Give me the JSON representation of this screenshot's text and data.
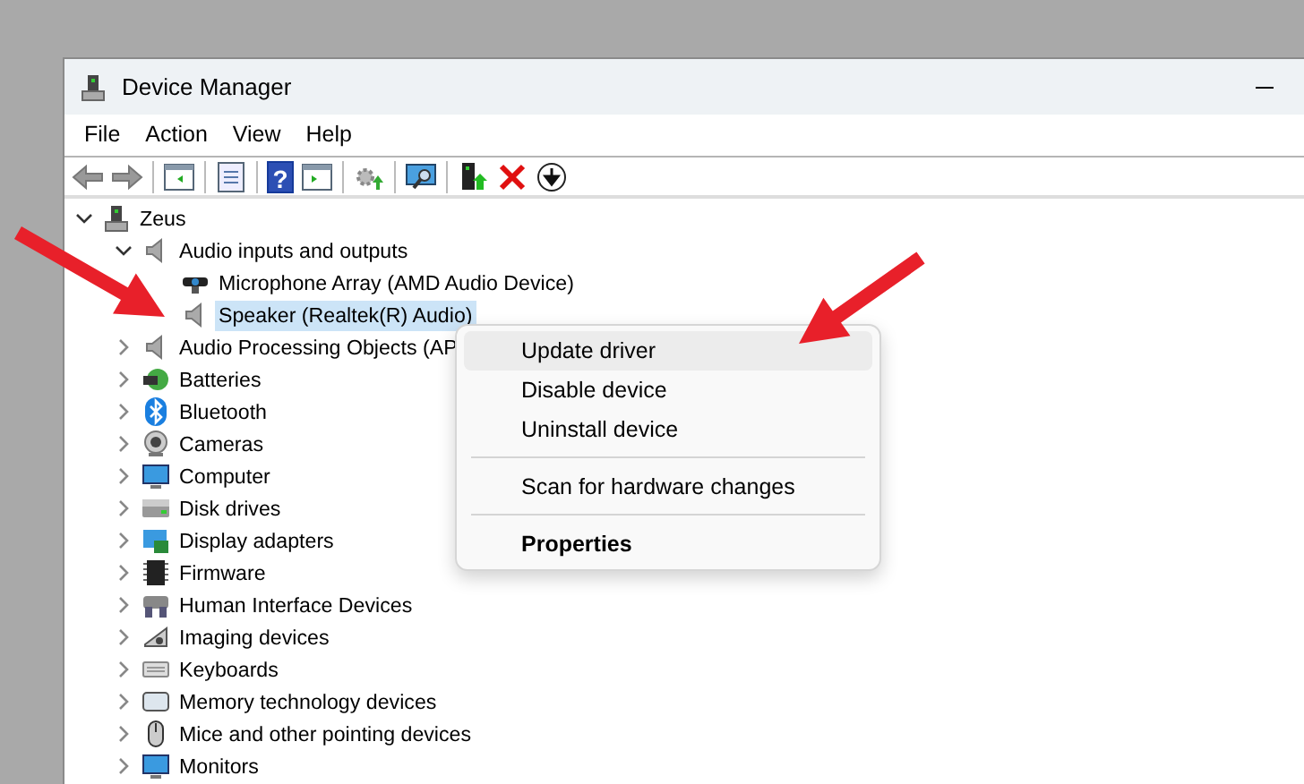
{
  "window": {
    "title": "Device Manager"
  },
  "menu": [
    "File",
    "Action",
    "View",
    "Help"
  ],
  "toolbar": [
    {
      "kind": "back"
    },
    {
      "kind": "forward"
    },
    {
      "kind": "sep"
    },
    {
      "kind": "pane"
    },
    {
      "kind": "sep"
    },
    {
      "kind": "sheet"
    },
    {
      "kind": "sep"
    },
    {
      "kind": "help",
      "label": "?"
    },
    {
      "kind": "pane2"
    },
    {
      "kind": "sep"
    },
    {
      "kind": "gear"
    },
    {
      "kind": "sep"
    },
    {
      "kind": "scan"
    },
    {
      "kind": "sep"
    },
    {
      "kind": "update"
    },
    {
      "kind": "remove"
    },
    {
      "kind": "down"
    }
  ],
  "tree": [
    {
      "label": "Zeus",
      "expanded": true,
      "selected": false,
      "children": [
        {
          "label": "Audio inputs and outputs",
          "expanded": true,
          "selected": false,
          "children": [
            {
              "label": "Microphone Array (AMD Audio Device)",
              "selected": false
            },
            {
              "label": "Speaker (Realtek(R) Audio)",
              "selected": true
            }
          ]
        },
        {
          "label": "Audio Processing Objects (AP",
          "expanded": false,
          "selected": false
        },
        {
          "label": "Batteries",
          "expanded": false,
          "selected": false
        },
        {
          "label": "Bluetooth",
          "expanded": false,
          "selected": false
        },
        {
          "label": "Cameras",
          "expanded": false,
          "selected": false
        },
        {
          "label": "Computer",
          "expanded": false,
          "selected": false
        },
        {
          "label": "Disk drives",
          "expanded": false,
          "selected": false
        },
        {
          "label": "Display adapters",
          "expanded": false,
          "selected": false
        },
        {
          "label": "Firmware",
          "expanded": false,
          "selected": false
        },
        {
          "label": "Human Interface Devices",
          "expanded": false,
          "selected": false
        },
        {
          "label": "Imaging devices",
          "expanded": false,
          "selected": false
        },
        {
          "label": "Keyboards",
          "expanded": false,
          "selected": false
        },
        {
          "label": "Memory technology devices",
          "expanded": false,
          "selected": false
        },
        {
          "label": "Mice and other pointing devices",
          "expanded": false,
          "selected": false
        },
        {
          "label": "Monitors",
          "expanded": false,
          "selected": false
        }
      ]
    }
  ],
  "context_menu": [
    {
      "kind": "item",
      "label": "Update driver",
      "selected": true,
      "bold": false
    },
    {
      "kind": "item",
      "label": "Disable device",
      "selected": false,
      "bold": false
    },
    {
      "kind": "item",
      "label": "Uninstall device",
      "selected": false,
      "bold": false
    },
    {
      "kind": "separator"
    },
    {
      "kind": "item",
      "label": "Scan for hardware changes",
      "selected": false,
      "bold": false
    },
    {
      "kind": "separator"
    },
    {
      "kind": "item",
      "label": "Properties",
      "selected": false,
      "bold": true
    }
  ]
}
